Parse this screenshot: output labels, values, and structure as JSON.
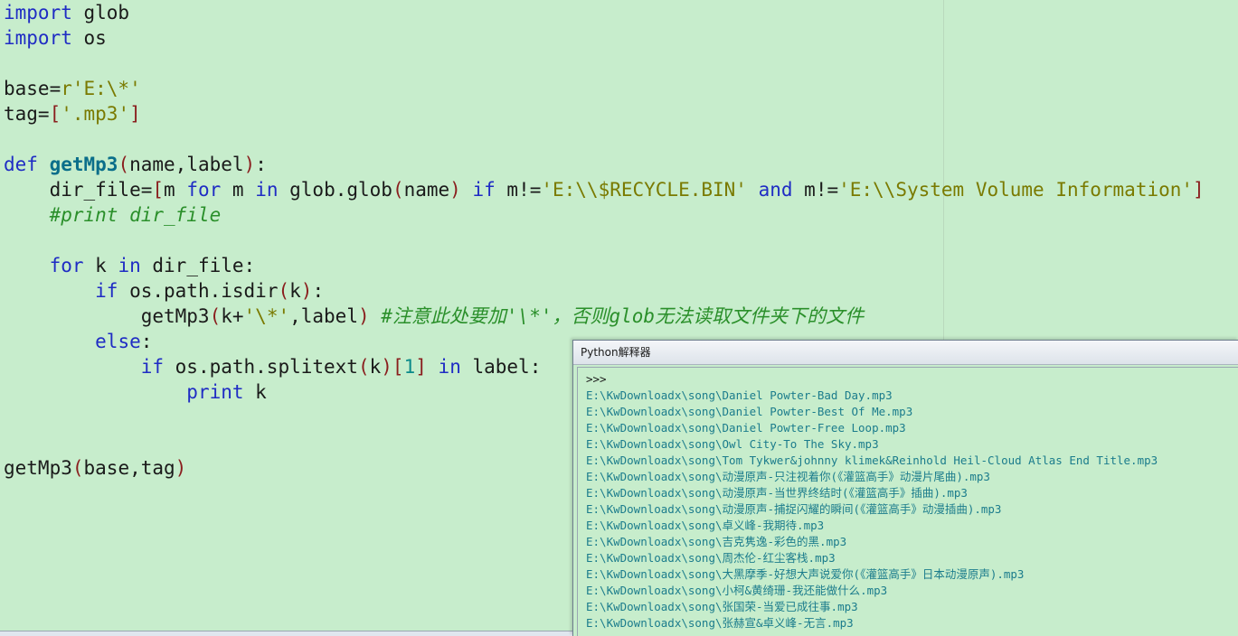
{
  "editor": {
    "lines": [
      [
        {
          "c": "kw",
          "t": "import"
        },
        {
          "c": "op",
          "t": " glob"
        }
      ],
      [
        {
          "c": "kw",
          "t": "import"
        },
        {
          "c": "op",
          "t": " os"
        }
      ],
      [],
      [
        {
          "c": "op",
          "t": "base="
        },
        {
          "c": "str",
          "t": "r'E:\\*'"
        }
      ],
      [
        {
          "c": "op",
          "t": "tag="
        },
        {
          "c": "paren",
          "t": "["
        },
        {
          "c": "str",
          "t": "'.mp3'"
        },
        {
          "c": "paren",
          "t": "]"
        }
      ],
      [],
      [
        {
          "c": "kw",
          "t": "def"
        },
        {
          "c": "op",
          "t": " "
        },
        {
          "c": "fn",
          "t": "getMp3"
        },
        {
          "c": "paren",
          "t": "("
        },
        {
          "c": "op",
          "t": "name,label"
        },
        {
          "c": "paren",
          "t": ")"
        },
        {
          "c": "op",
          "t": ":"
        }
      ],
      [
        {
          "c": "op",
          "t": "    dir_file="
        },
        {
          "c": "paren",
          "t": "["
        },
        {
          "c": "op",
          "t": "m "
        },
        {
          "c": "kw",
          "t": "for"
        },
        {
          "c": "op",
          "t": " m "
        },
        {
          "c": "kw",
          "t": "in"
        },
        {
          "c": "op",
          "t": " glob.glob"
        },
        {
          "c": "paren",
          "t": "("
        },
        {
          "c": "op",
          "t": "name"
        },
        {
          "c": "paren",
          "t": ")"
        },
        {
          "c": "op",
          "t": " "
        },
        {
          "c": "kw",
          "t": "if"
        },
        {
          "c": "op",
          "t": " m!="
        },
        {
          "c": "str",
          "t": "'E:\\\\$RECYCLE.BIN'"
        },
        {
          "c": "op",
          "t": " "
        },
        {
          "c": "kw",
          "t": "and"
        },
        {
          "c": "op",
          "t": " m!="
        },
        {
          "c": "str",
          "t": "'E:\\\\System Volume Information'"
        },
        {
          "c": "paren",
          "t": "]"
        }
      ],
      [
        {
          "c": "comment",
          "t": "    #print dir_file"
        }
      ],
      [],
      [
        {
          "c": "op",
          "t": "    "
        },
        {
          "c": "kw",
          "t": "for"
        },
        {
          "c": "op",
          "t": " k "
        },
        {
          "c": "kw",
          "t": "in"
        },
        {
          "c": "op",
          "t": " dir_file:"
        }
      ],
      [
        {
          "c": "op",
          "t": "        "
        },
        {
          "c": "kw",
          "t": "if"
        },
        {
          "c": "op",
          "t": " os.path.isdir"
        },
        {
          "c": "paren",
          "t": "("
        },
        {
          "c": "op",
          "t": "k"
        },
        {
          "c": "paren",
          "t": ")"
        },
        {
          "c": "op",
          "t": ":"
        }
      ],
      [
        {
          "c": "op",
          "t": "            getMp3"
        },
        {
          "c": "paren",
          "t": "("
        },
        {
          "c": "op",
          "t": "k+"
        },
        {
          "c": "str",
          "t": "'\\*'"
        },
        {
          "c": "op",
          "t": ",label"
        },
        {
          "c": "paren",
          "t": ")"
        },
        {
          "c": "op",
          "t": " "
        },
        {
          "c": "comment",
          "t": "#注意此处要加'\\*'，否则glob无法读取文件夹下的文件"
        }
      ],
      [
        {
          "c": "op",
          "t": "        "
        },
        {
          "c": "kw",
          "t": "else"
        },
        {
          "c": "op",
          "t": ":"
        }
      ],
      [
        {
          "c": "op",
          "t": "            "
        },
        {
          "c": "kw",
          "t": "if"
        },
        {
          "c": "op",
          "t": " os.path.splitext"
        },
        {
          "c": "paren",
          "t": "("
        },
        {
          "c": "op",
          "t": "k"
        },
        {
          "c": "paren",
          "t": ")"
        },
        {
          "c": "paren",
          "t": "["
        },
        {
          "c": "num",
          "t": "1"
        },
        {
          "c": "paren",
          "t": "]"
        },
        {
          "c": "op",
          "t": " "
        },
        {
          "c": "kw",
          "t": "in"
        },
        {
          "c": "op",
          "t": " label:"
        }
      ],
      [
        {
          "c": "op",
          "t": "                "
        },
        {
          "c": "kw",
          "t": "print"
        },
        {
          "c": "op",
          "t": " k"
        }
      ],
      [],
      [],
      [
        {
          "c": "op",
          "t": "getMp3"
        },
        {
          "c": "paren",
          "t": "("
        },
        {
          "c": "op",
          "t": "base,tag"
        },
        {
          "c": "paren",
          "t": ")"
        }
      ]
    ]
  },
  "shell": {
    "title": "Python解释器",
    "prompt": ">>>",
    "output": [
      "E:\\KwDownloadx\\song\\Daniel Powter-Bad Day.mp3",
      "E:\\KwDownloadx\\song\\Daniel Powter-Best Of Me.mp3",
      "E:\\KwDownloadx\\song\\Daniel Powter-Free Loop.mp3",
      "E:\\KwDownloadx\\song\\Owl City-To The Sky.mp3",
      "E:\\KwDownloadx\\song\\Tom Tykwer&johnny klimek&Reinhold Heil-Cloud Atlas End Title.mp3",
      "E:\\KwDownloadx\\song\\动漫原声-只注视着你(《灌篮高手》动漫片尾曲).mp3",
      "E:\\KwDownloadx\\song\\动漫原声-当世界终结时(《灌篮高手》插曲).mp3",
      "E:\\KwDownloadx\\song\\动漫原声-捕捉闪耀的瞬间(《灌篮高手》动漫插曲).mp3",
      "E:\\KwDownloadx\\song\\卓义峰-我期待.mp3",
      "E:\\KwDownloadx\\song\\吉克隽逸-彩色的黑.mp3",
      "E:\\KwDownloadx\\song\\周杰伦-红尘客栈.mp3",
      "E:\\KwDownloadx\\song\\大黑摩季-好想大声说爱你(《灌篮高手》日本动漫原声).mp3",
      "E:\\KwDownloadx\\song\\小柯&黄绮珊-我还能做什么.mp3",
      "E:\\KwDownloadx\\song\\张国荣-当爱已成往事.mp3",
      "E:\\KwDownloadx\\song\\张赫宣&卓义峰-无言.mp3"
    ]
  }
}
